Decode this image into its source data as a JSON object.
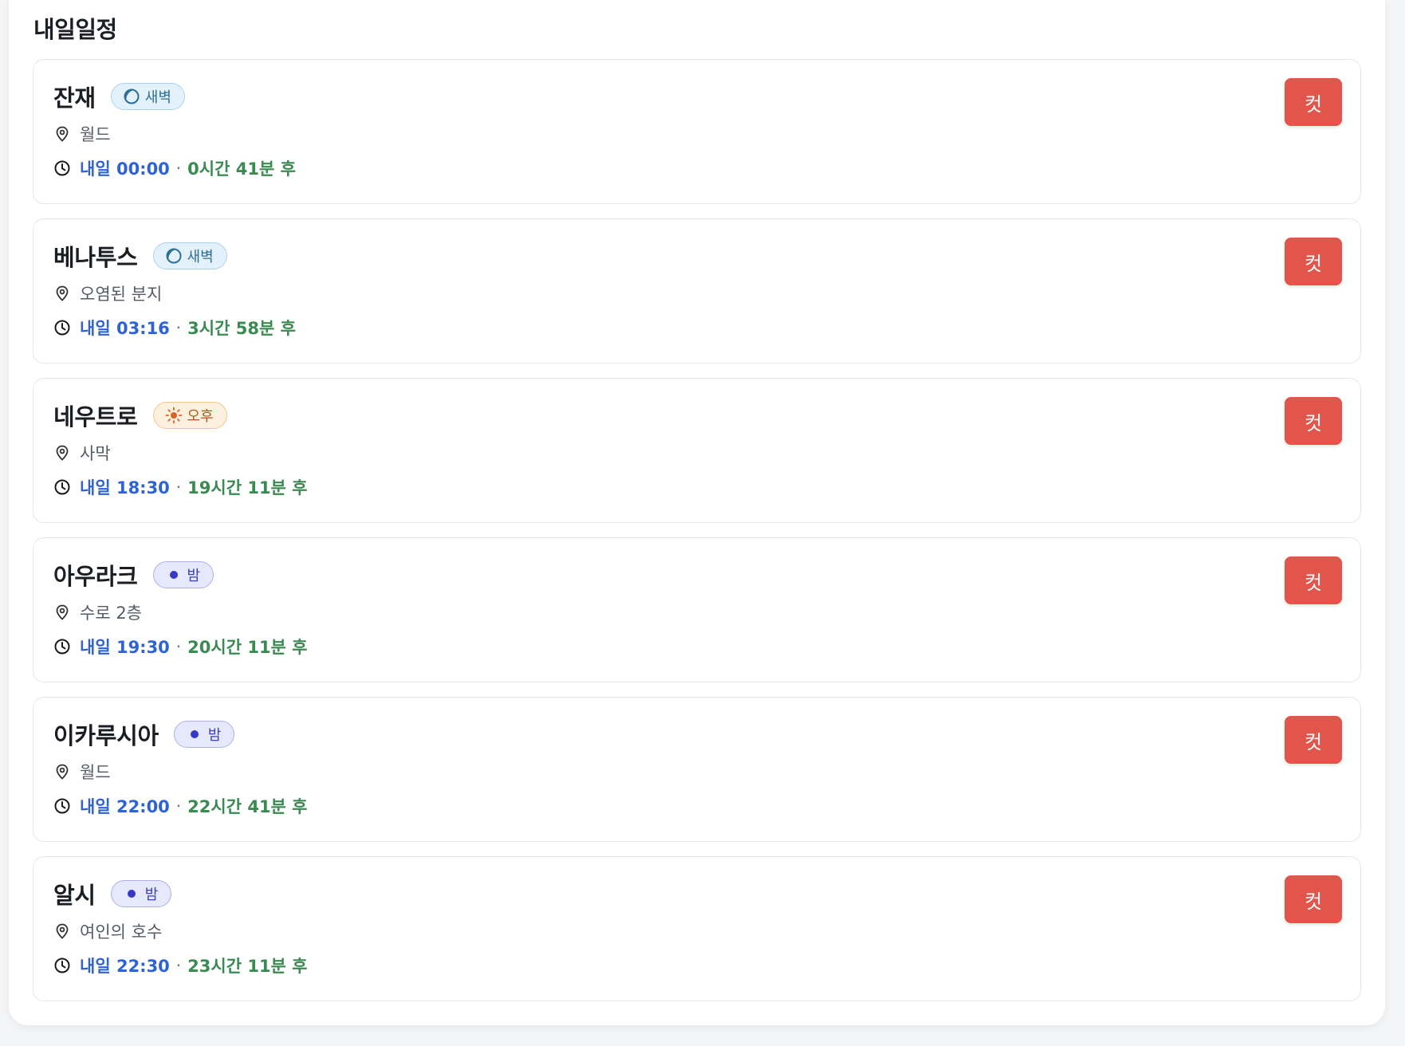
{
  "section": {
    "title": "내일일정"
  },
  "colors": {
    "accent_time": "#2f62d6",
    "accent_remaining": "#3a8a52",
    "cut_button": "#e2554b",
    "badge_dawn": "#e3f1fb",
    "badge_afternoon": "#fdf0de",
    "badge_night": "#e6e8fb"
  },
  "schedules": [
    {
      "name": "잔재",
      "period": "새벽",
      "period_icon": "moon-icon",
      "location": "월드",
      "time": "내일 00:00",
      "separator": "·",
      "remaining": "0시간 41분 후",
      "button": "컷"
    },
    {
      "name": "베나투스",
      "period": "새벽",
      "period_icon": "moon-icon",
      "location": "오염된 분지",
      "time": "내일 03:16",
      "separator": "·",
      "remaining": "3시간 58분 후",
      "button": "컷"
    },
    {
      "name": "네우트로",
      "period": "오후",
      "period_icon": "sun-icon",
      "location": "사막",
      "time": "내일 18:30",
      "separator": "·",
      "remaining": "19시간 11분 후",
      "button": "컷"
    },
    {
      "name": "아우라크",
      "period": "밤",
      "period_icon": "dot-icon",
      "location": "수로 2층",
      "time": "내일 19:30",
      "separator": "·",
      "remaining": "20시간 11분 후",
      "button": "컷"
    },
    {
      "name": "이카루시아",
      "period": "밤",
      "period_icon": "dot-icon",
      "location": "월드",
      "time": "내일 22:00",
      "separator": "·",
      "remaining": "22시간 41분 후",
      "button": "컷"
    },
    {
      "name": "알시",
      "period": "밤",
      "period_icon": "dot-icon",
      "location": "여인의 호수",
      "time": "내일 22:30",
      "separator": "·",
      "remaining": "23시간 11분 후",
      "button": "컷"
    }
  ]
}
